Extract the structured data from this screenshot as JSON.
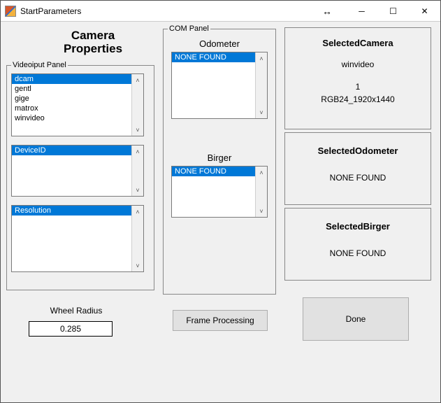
{
  "window": {
    "title": "StartParameters"
  },
  "heading": "Camera Properties",
  "panels": {
    "video_legend": "Videoiput Panel",
    "com_legend": "COM Panel"
  },
  "adaptors": {
    "items": [
      "dcam",
      "gentl",
      "gige",
      "matrox",
      "winvideo"
    ],
    "selected": "dcam"
  },
  "deviceid": {
    "label": "DeviceID",
    "items": [],
    "selected": "DeviceID"
  },
  "resolution": {
    "label": "Resolution",
    "items": [],
    "selected": "Resolution"
  },
  "odometer": {
    "label": "Odometer",
    "items": [
      "NONE FOUND"
    ],
    "selected": "NONE FOUND"
  },
  "birger": {
    "label": "Birger",
    "items": [
      "NONE FOUND"
    ],
    "selected": "NONE FOUND"
  },
  "selected_camera": {
    "title": "SelectedCamera",
    "adaptor": "winvideo",
    "device": "1",
    "format": "RGB24_1920x1440"
  },
  "selected_odometer": {
    "title": "SelectedOdometer",
    "value": "NONE FOUND"
  },
  "selected_birger": {
    "title": "SelectedBirger",
    "value": "NONE FOUND"
  },
  "wheel": {
    "label": "Wheel Radius",
    "value": "0.285"
  },
  "buttons": {
    "frame": "Frame Processing",
    "done": "Done"
  }
}
